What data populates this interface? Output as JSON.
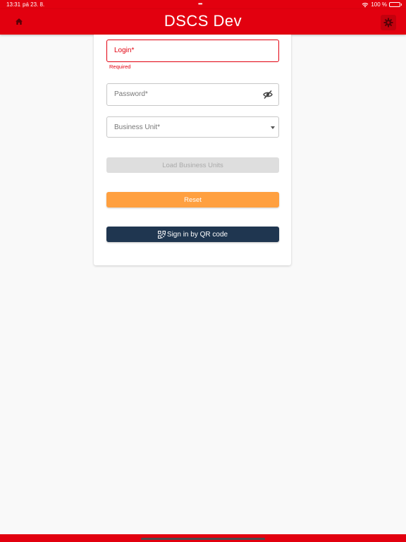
{
  "status": {
    "time": "13:31",
    "date": "pá 23. 8.",
    "battery_percent": "100 %",
    "battery_level": 1.0
  },
  "appbar": {
    "title": "DSCS Dev",
    "home_icon": "home-icon",
    "settings_icon": "gear-icon"
  },
  "form": {
    "login": {
      "label": "Login*",
      "value": "",
      "helper": "Required"
    },
    "password": {
      "label": "Password*",
      "value": "",
      "icon": "eye-off-icon"
    },
    "business_unit": {
      "label": "Business Unit*",
      "value": ""
    }
  },
  "buttons": {
    "load_business_units": "Load Business Units",
    "reset": "Reset",
    "sign_in_qr": "Sign in by QR code"
  },
  "colors": {
    "primary": "#e2000f",
    "reset": "#ffa040",
    "qr_button": "#1f3650"
  }
}
